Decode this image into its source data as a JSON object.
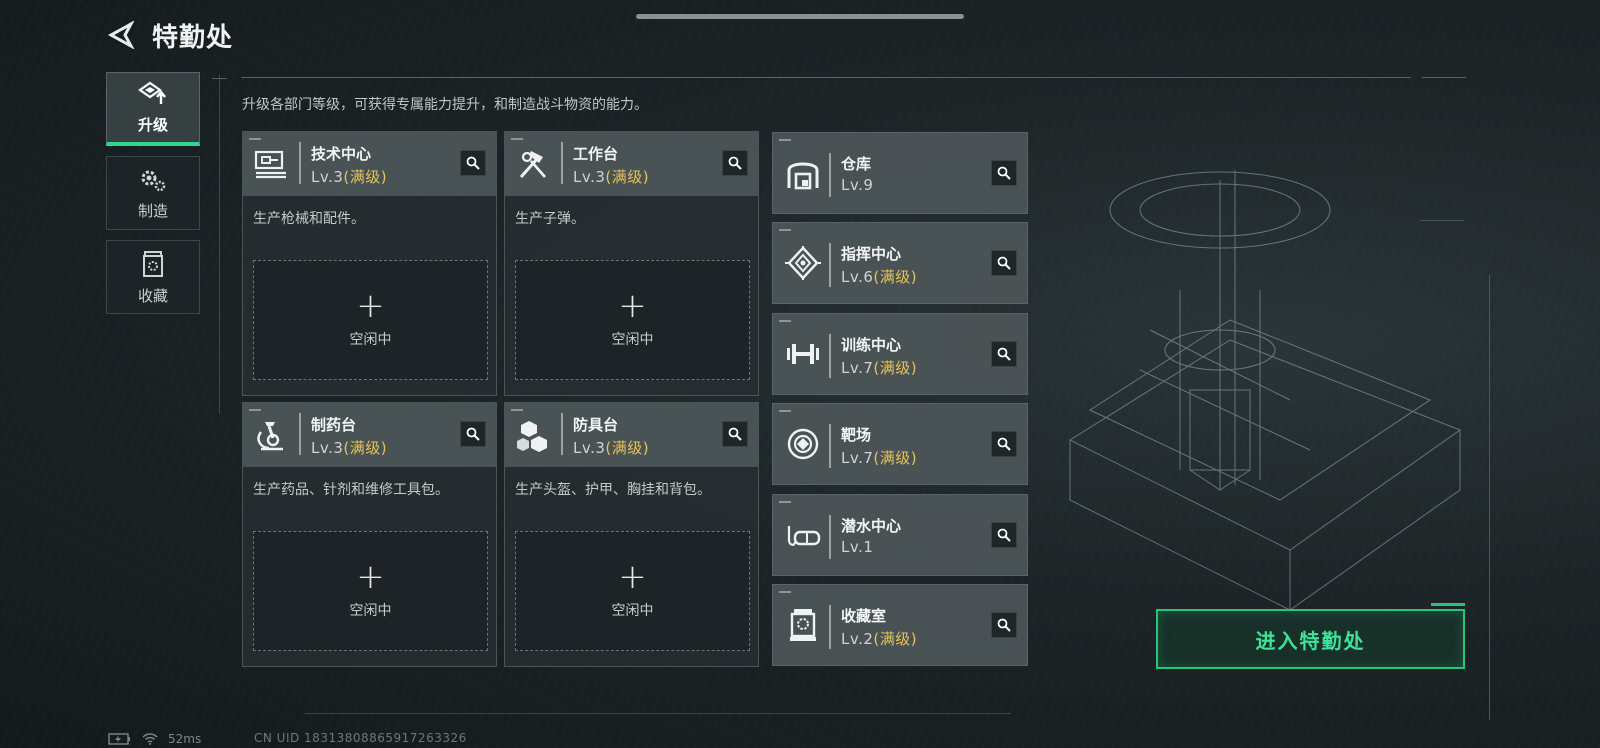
{
  "header": {
    "title": "特勤处"
  },
  "sidebar": {
    "tabs": [
      {
        "label": "升级",
        "icon": "upgrade-icon",
        "active": true
      },
      {
        "label": "制造",
        "icon": "gears-icon",
        "active": false
      },
      {
        "label": "收藏",
        "icon": "collection-icon",
        "active": false
      }
    ]
  },
  "main": {
    "description": "升级各部门等级，可获得专属能力提升，和制造战斗物资的能力。",
    "max_label": "(满级)",
    "departments": [
      {
        "name": "技术中心",
        "level": "Lv.3",
        "max": true,
        "desc": "生产枪械和配件。",
        "slot_label": "空闲中",
        "icon": "tech-center-icon"
      },
      {
        "name": "工作台",
        "level": "Lv.3",
        "max": true,
        "desc": "生产子弹。",
        "slot_label": "空闲中",
        "icon": "hammer-wrench-icon"
      },
      {
        "name": "制药台",
        "level": "Lv.3",
        "max": true,
        "desc": "生产药品、针剂和维修工具包。",
        "slot_label": "空闲中",
        "icon": "microscope-icon"
      },
      {
        "name": "防具台",
        "level": "Lv.3",
        "max": true,
        "desc": "生产头盔、护甲、胸挂和背包。",
        "slot_label": "空闲中",
        "icon": "armor-cubes-icon"
      }
    ],
    "facilities": [
      {
        "name": "仓库",
        "level": "Lv.9",
        "max": false,
        "icon": "warehouse-icon"
      },
      {
        "name": "指挥中心",
        "level": "Lv.6",
        "max": true,
        "icon": "command-chip-icon"
      },
      {
        "name": "训练中心",
        "level": "Lv.7",
        "max": true,
        "icon": "dumbbell-icon"
      },
      {
        "name": "靶场",
        "level": "Lv.7",
        "max": true,
        "icon": "target-icon"
      },
      {
        "name": "潜水中心",
        "level": "Lv.1",
        "max": false,
        "icon": "diving-mask-icon"
      },
      {
        "name": "收藏室",
        "level": "Lv.2",
        "max": true,
        "icon": "display-case-icon"
      }
    ]
  },
  "enter_button": {
    "label": "进入特勤处"
  },
  "status_bar": {
    "ping": "52ms",
    "uid": "CN UID 18313808865917263326"
  },
  "colors": {
    "accent": "#30d68e",
    "max_level": "#e6c35a"
  }
}
